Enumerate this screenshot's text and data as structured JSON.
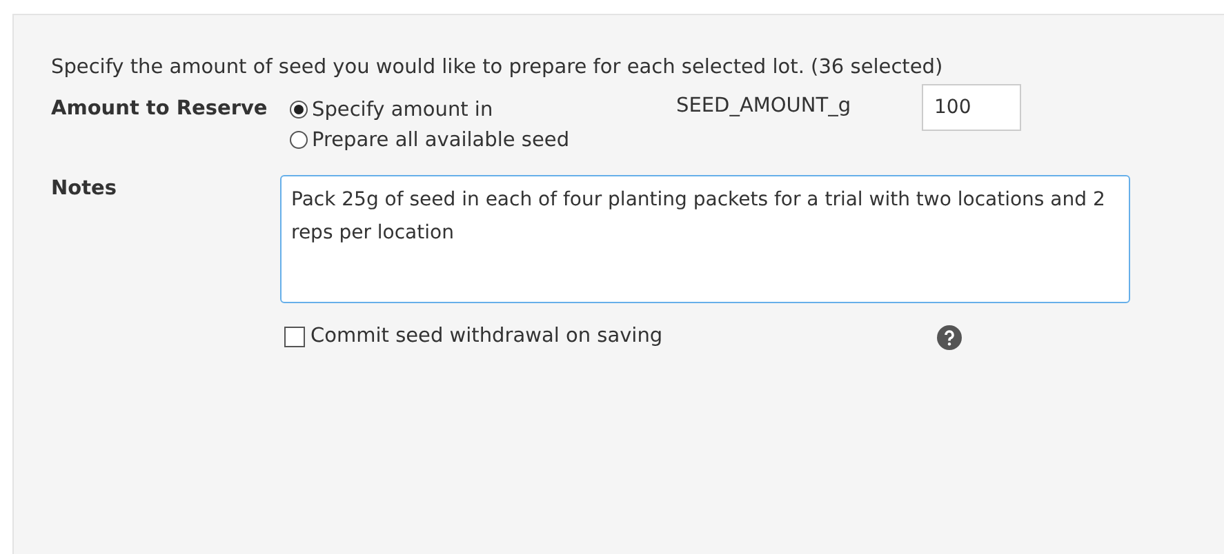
{
  "intro": "Specify the amount of seed you would like to prepare for each selected lot. (36 selected)",
  "amount": {
    "label": "Amount to Reserve",
    "options": [
      {
        "label": "Specify amount in",
        "selected": true
      },
      {
        "label": "Prepare all available seed",
        "selected": false
      }
    ],
    "unit_label": "SEED_AMOUNT_g",
    "value": "100"
  },
  "notes": {
    "label": "Notes",
    "value": "Pack 25g of seed in each of four planting packets for a trial with two locations and 2 reps per location"
  },
  "commit": {
    "label": "Commit seed withdrawal on saving",
    "checked": false
  }
}
